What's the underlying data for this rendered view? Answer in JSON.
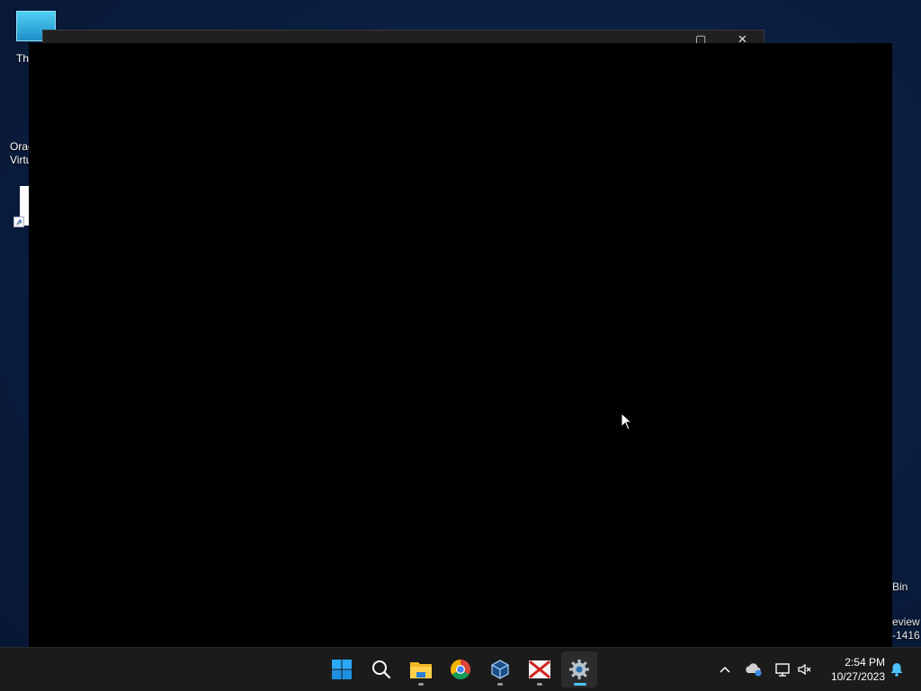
{
  "desktop": {
    "icons": [
      {
        "label": "Th",
        "icon": "this-pc-icon"
      },
      {
        "label1": "Orac",
        "label2": "Virtu",
        "icon": "virtualbox-shortcut-icon"
      }
    ],
    "right_labels": {
      "bin": "Bin",
      "eval_line1": "eview",
      "eval_line2": "-1416"
    }
  },
  "window": {
    "maximize_glyph": "▢",
    "close_glyph": "✕"
  },
  "taskbar": {
    "apps": [
      {
        "name": "start",
        "icon": "windows-start-icon"
      },
      {
        "name": "search",
        "icon": "search-icon"
      },
      {
        "name": "file-explorer",
        "icon": "folder-icon"
      },
      {
        "name": "chrome",
        "icon": "chrome-icon"
      },
      {
        "name": "virtualbox",
        "icon": "virtualbox-icon"
      },
      {
        "name": "x-app",
        "icon": "red-x-icon"
      },
      {
        "name": "settings",
        "icon": "gear-icon"
      }
    ],
    "tray": {
      "chevron": "^",
      "time": "2:54 PM",
      "date": "10/27/2023"
    }
  },
  "colors": {
    "accent": "#4cc2ff",
    "taskbar": "#1b1b1b"
  }
}
